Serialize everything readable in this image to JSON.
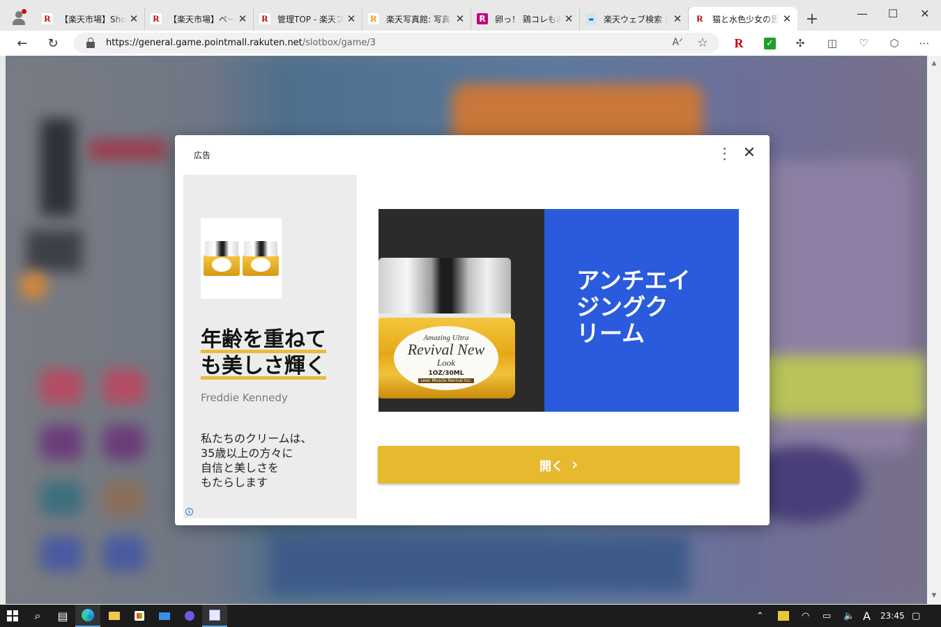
{
  "browser": {
    "tabs": [
      {
        "favicon": "rakuten-r-icon",
        "title": "【楽天市場】Shopp",
        "active": false
      },
      {
        "favicon": "rakuten-r-icon",
        "title": "【楽天市場】ページ",
        "active": false
      },
      {
        "favicon": "rakuten-r-icon",
        "title": "管理TOP - 楽天ブ",
        "active": false
      },
      {
        "favicon": "rakuten-photo-icon",
        "title": "楽天写真館: 写真",
        "active": false
      },
      {
        "favicon": "rakuten-pink-icon",
        "title": "卵っ！ 鶏コレもお気",
        "active": false
      },
      {
        "favicon": "web-search-icon",
        "title": "楽天ウェブ検索｜楽",
        "active": false
      },
      {
        "favicon": "rakuten-r-icon",
        "title": "猫と水色少女の思",
        "active": true
      }
    ],
    "url_host": "https://general.game.pointmall.rakuten.net",
    "url_path": "/slotbox/game/3"
  },
  "ad": {
    "label": "広告",
    "headline_line1": "年齢を重ねて",
    "headline_line2": "も美しさ輝く",
    "advertiser": "Freddie Kennedy",
    "description_lines": [
      "私たちのクリームは、",
      "35歳以上の方々に",
      "自信と美しさを",
      "もたらします"
    ],
    "creative_text_lines": [
      "アンチエイ",
      "ジングク",
      "リーム"
    ],
    "jar_label": {
      "line1": "Amazing Ultra",
      "line2": "Revival New",
      "line3": "Look",
      "line4": "1OZ/30ML",
      "line5": "Lean Muscle Revival Inc."
    },
    "cta_label": "開く",
    "cta_color": "#e6b92f",
    "creative_blue": "#2a5bdc"
  },
  "taskbar": {
    "clock": "23:45",
    "input_indicator": "A"
  }
}
